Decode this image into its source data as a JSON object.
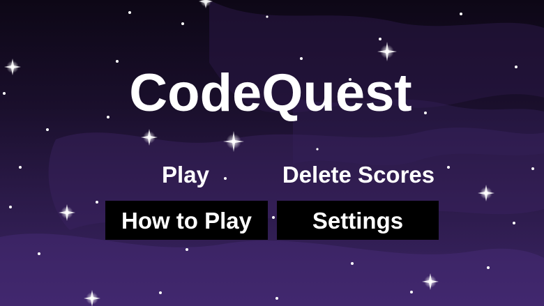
{
  "game": {
    "title": "CodeQuest"
  },
  "menu": {
    "play": "Play",
    "delete_scores": "Delete Scores",
    "how_to_play": "How to Play",
    "settings": "Settings"
  },
  "colors": {
    "background_top": "#0d0716",
    "background_bottom": "#3c2566",
    "text": "#ffffff",
    "button_bg": "#000000"
  }
}
